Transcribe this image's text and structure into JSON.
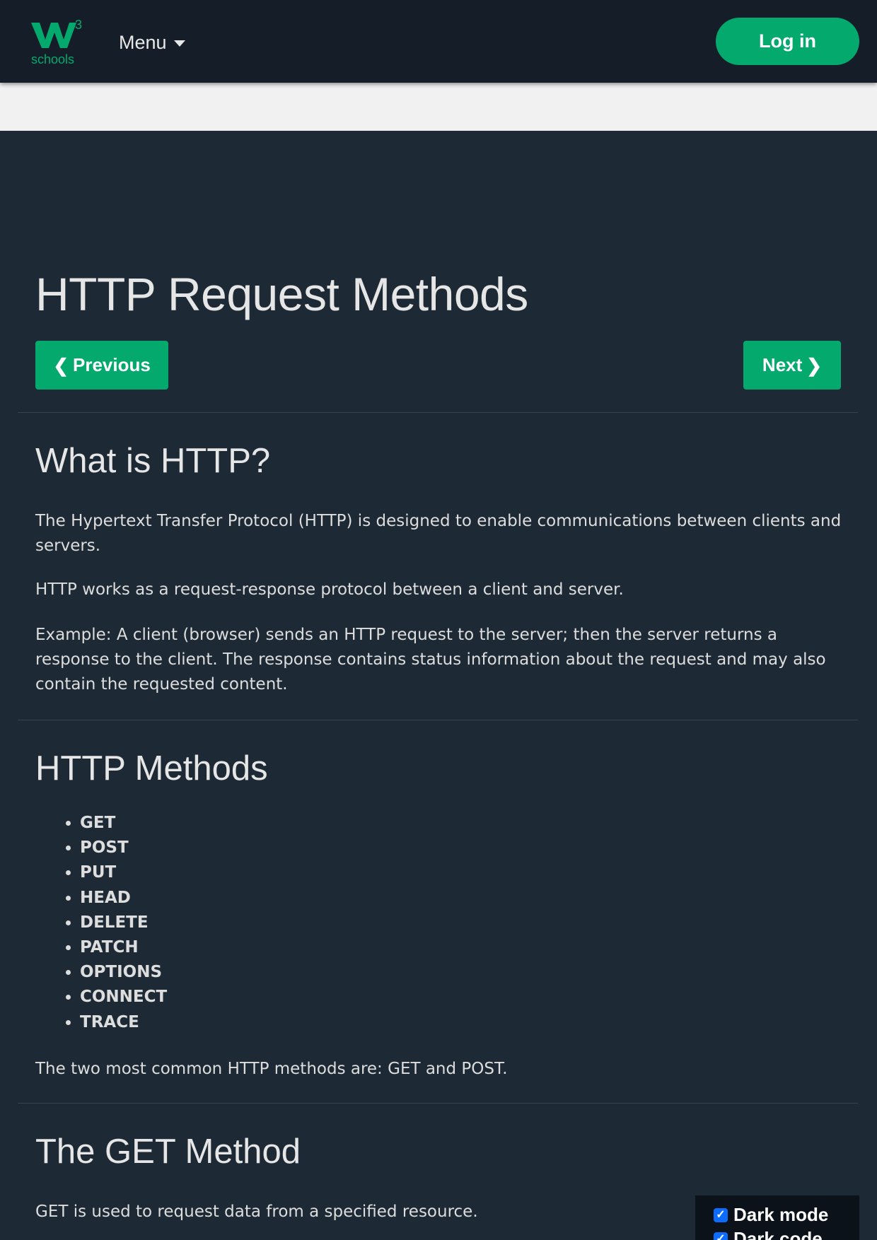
{
  "header": {
    "logo_text": "schools",
    "logo_superscript": "3",
    "menu_label": "Menu",
    "login_label": "Log in"
  },
  "page": {
    "title": "HTTP Request Methods",
    "prev_label": "Previous",
    "next_label": "Next"
  },
  "sections": {
    "what_is_http": {
      "heading": "What is HTTP?",
      "p1": "The Hypertext Transfer Protocol (HTTP) is designed to enable communications between clients and servers.",
      "p2": "HTTP works as a request-response protocol between a client and server.",
      "p3": "Example: A client (browser) sends an HTTP request to the server; then the server returns a response to the client. The response contains status information about the request and may also contain the requested content."
    },
    "http_methods": {
      "heading": "HTTP Methods",
      "items": [
        "GET",
        "POST",
        "PUT",
        "HEAD",
        "DELETE",
        "PATCH",
        "OPTIONS",
        "CONNECT",
        "TRACE"
      ],
      "summary": "The two most common HTTP methods are: GET and POST."
    },
    "get_method": {
      "heading": "The GET Method",
      "p1": "GET is used to request data from a specified resource."
    }
  },
  "dark_mode": {
    "label": "Dark mode",
    "label_2": "Dark code",
    "checked": true
  },
  "colors": {
    "accent": "#04aa6d",
    "background": "#1d2a35",
    "topbar": "#151d28"
  }
}
